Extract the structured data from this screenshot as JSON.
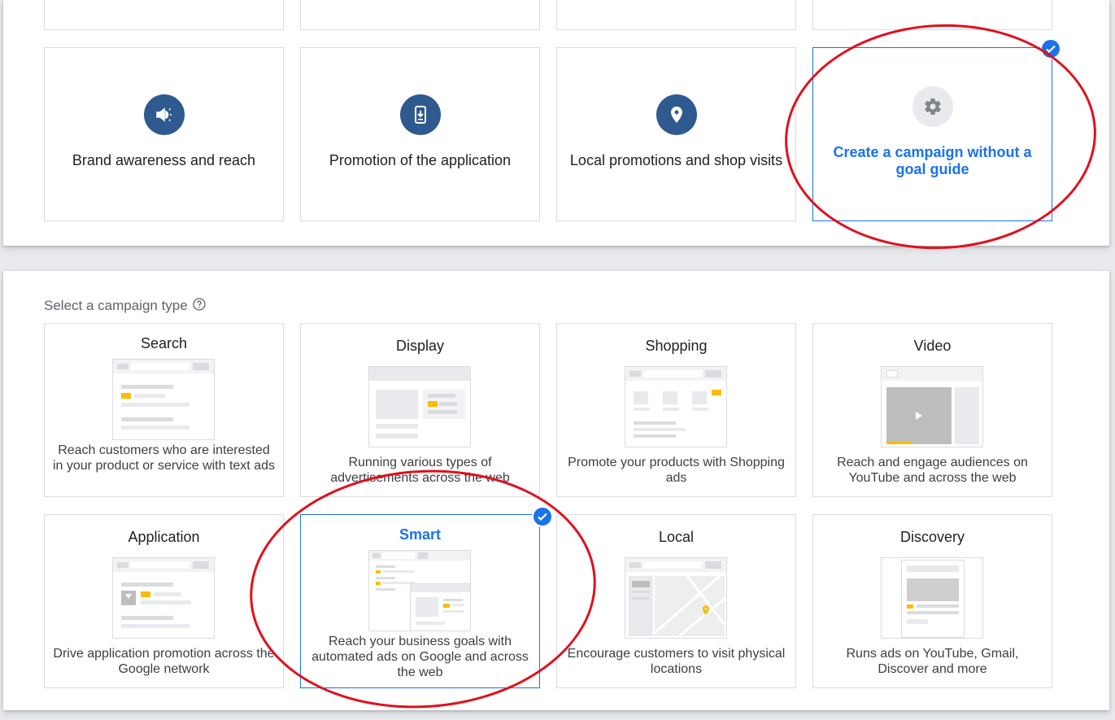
{
  "goals": {
    "cards": [
      {
        "label": "Brand awareness and reach",
        "icon": "megaphone-icon"
      },
      {
        "label": "Promotion of the application",
        "icon": "phone-download-icon"
      },
      {
        "label": "Local promotions and shop visits",
        "icon": "location-pin-icon"
      },
      {
        "label": "Create a campaign without a goal guide",
        "icon": "gear-icon",
        "selected": true
      }
    ]
  },
  "campaign_types": {
    "heading": "Select a campaign type",
    "help_icon": "help-circle-icon",
    "cards": [
      {
        "title": "Search",
        "description": "Reach customers who are interested in your product or service with text ads"
      },
      {
        "title": "Display",
        "description": "Running various types of advertisements across the web"
      },
      {
        "title": "Shopping",
        "description": "Promote your products with Shopping ads"
      },
      {
        "title": "Video",
        "description": "Reach and engage audiences on YouTube and across the web"
      },
      {
        "title": "Application",
        "description": "Drive application promotion across the Google network"
      },
      {
        "title": "Smart",
        "description": "Reach your business goals with automated ads on Google and across the web",
        "selected": true
      },
      {
        "title": "Local",
        "description": "Encourage customers to visit physical locations"
      },
      {
        "title": "Discovery",
        "description": "Runs ads on YouTube, Gmail, Discover and more"
      }
    ]
  },
  "colors": {
    "accent": "#1a73e8",
    "icon_circle": "#2f5a8f",
    "highlight": "#fbbc04",
    "annotation": "#e0101c"
  }
}
